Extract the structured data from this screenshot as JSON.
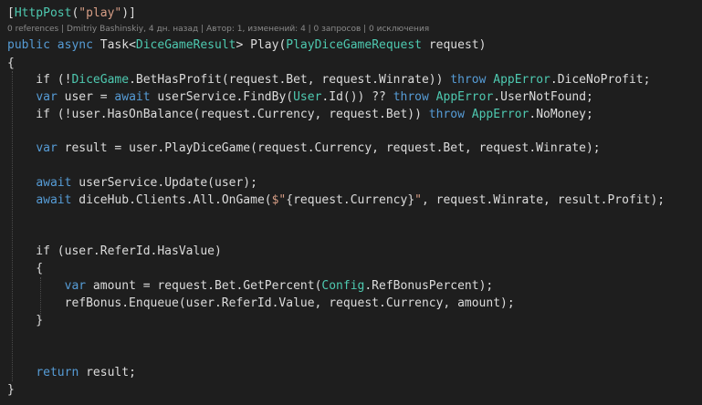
{
  "code_lens": {
    "text": "0 references | Dmitriy Bashinskiy, 4 дн. назад | Автор: 1, изменений: 4 | 0 запросов | 0 исключения"
  },
  "lines": [
    [
      {
        "t": "[",
        "c": "p"
      },
      {
        "t": "HttpPost",
        "c": "ty"
      },
      {
        "t": "(",
        "c": "p"
      },
      {
        "t": "\"play\"",
        "c": "st"
      },
      {
        "t": ")]",
        "c": "p"
      }
    ],
    null,
    [
      {
        "t": "public",
        "c": "kw"
      },
      {
        "t": " ",
        "c": "p"
      },
      {
        "t": "async",
        "c": "kw"
      },
      {
        "t": " Task<",
        "c": "p"
      },
      {
        "t": "DiceGameResult",
        "c": "ty"
      },
      {
        "t": "> Play(",
        "c": "p"
      },
      {
        "t": "PlayDiceGameRequest",
        "c": "ty"
      },
      {
        "t": " request)",
        "c": "p"
      }
    ],
    [
      {
        "t": "{",
        "c": "p"
      }
    ],
    [
      {
        "t": "    if (!",
        "c": "p"
      },
      {
        "t": "DiceGame",
        "c": "ty"
      },
      {
        "t": ".BetHasProfit(request.Bet, request.Winrate)) ",
        "c": "p"
      },
      {
        "t": "throw",
        "c": "kw"
      },
      {
        "t": " ",
        "c": "p"
      },
      {
        "t": "AppError",
        "c": "ty"
      },
      {
        "t": ".DiceNoProfit;",
        "c": "p"
      }
    ],
    [
      {
        "t": "    ",
        "c": "p"
      },
      {
        "t": "var",
        "c": "kw"
      },
      {
        "t": " user = ",
        "c": "p"
      },
      {
        "t": "await",
        "c": "kw"
      },
      {
        "t": " userService.FindBy(",
        "c": "p"
      },
      {
        "t": "User",
        "c": "ty"
      },
      {
        "t": ".Id()) ?? ",
        "c": "p"
      },
      {
        "t": "throw",
        "c": "kw"
      },
      {
        "t": " ",
        "c": "p"
      },
      {
        "t": "AppError",
        "c": "ty"
      },
      {
        "t": ".UserNotFound;",
        "c": "p"
      }
    ],
    [
      {
        "t": "    if (!user.HasOnBalance(request.Currency, request.Bet)) ",
        "c": "p"
      },
      {
        "t": "throw",
        "c": "kw"
      },
      {
        "t": " ",
        "c": "p"
      },
      {
        "t": "AppError",
        "c": "ty"
      },
      {
        "t": ".NoMoney;",
        "c": "p"
      }
    ],
    [],
    [
      {
        "t": "    ",
        "c": "p"
      },
      {
        "t": "var",
        "c": "kw"
      },
      {
        "t": " result = user.PlayDiceGame(request.Currency, request.Bet, request.Winrate);",
        "c": "p"
      }
    ],
    [],
    [
      {
        "t": "    ",
        "c": "p"
      },
      {
        "t": "await",
        "c": "kw"
      },
      {
        "t": " userService.Update(user);",
        "c": "p"
      }
    ],
    [
      {
        "t": "    ",
        "c": "p"
      },
      {
        "t": "await",
        "c": "kw"
      },
      {
        "t": " diceHub.Clients.All.OnGame(",
        "c": "p"
      },
      {
        "t": "$\"",
        "c": "st"
      },
      {
        "t": "{request.Currency}",
        "c": "p"
      },
      {
        "t": "\"",
        "c": "st"
      },
      {
        "t": ", request.Winrate, result.Profit);",
        "c": "p"
      }
    ],
    [],
    [],
    [
      {
        "t": "    if (user.ReferId.HasValue)",
        "c": "p"
      }
    ],
    [
      {
        "t": "    {",
        "c": "p"
      }
    ],
    [
      {
        "t": "        ",
        "c": "p"
      },
      {
        "t": "var",
        "c": "kw"
      },
      {
        "t": " amount = request.Bet.GetPercent(",
        "c": "p"
      },
      {
        "t": "Config",
        "c": "ty"
      },
      {
        "t": ".RefBonusPercent);",
        "c": "p"
      }
    ],
    [
      {
        "t": "        refBonus.Enqueue(user.ReferId.Value, request.Currency, amount);",
        "c": "p"
      }
    ],
    [
      {
        "t": "    }",
        "c": "p"
      }
    ],
    [],
    [],
    [
      {
        "t": "    ",
        "c": "p"
      },
      {
        "t": "return",
        "c": "kw"
      },
      {
        "t": " result;",
        "c": "p"
      }
    ],
    [
      {
        "t": "}",
        "c": "p"
      }
    ]
  ],
  "colors": {
    "background": "#1e1e1e",
    "keyword": "#569cd6",
    "type": "#4ec9b0",
    "string": "#d69d85",
    "plain": "#dcdcdc",
    "codelens": "#8a8a8a"
  }
}
